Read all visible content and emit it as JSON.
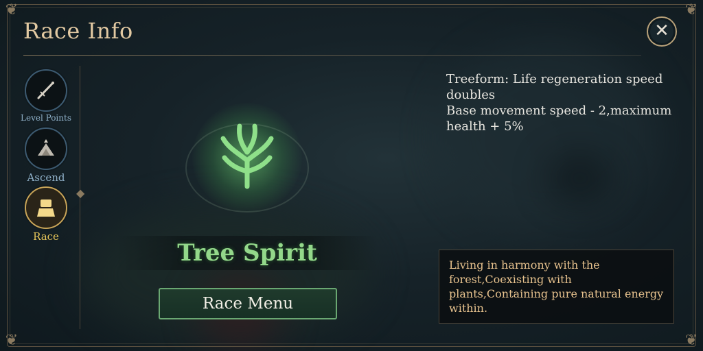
{
  "panel": {
    "title": "Race Info"
  },
  "sidebar": {
    "items": [
      {
        "label": "Level Points",
        "icon": "sword-icon",
        "active": false
      },
      {
        "label": "Ascend",
        "icon": "ascend-icon",
        "active": false
      },
      {
        "label": "Race",
        "icon": "race-icon",
        "active": true
      }
    ]
  },
  "race": {
    "name": "Tree Spirit",
    "emblem": "tree-emblem-icon",
    "menu_button": "Race Menu",
    "traits": [
      "Treeform: Life regeneration speed doubles",
      "Base movement speed - 2,maximum health + 5%"
    ],
    "description": "Living in harmony with the forest,Coexisting with plants,Containing pure natural energy within."
  },
  "colors": {
    "title": "#e2c9a2",
    "race_name": "#93d88a",
    "description": "#e7c28e",
    "active_tab": "#e7c65a",
    "button_border": "#6aa872"
  }
}
